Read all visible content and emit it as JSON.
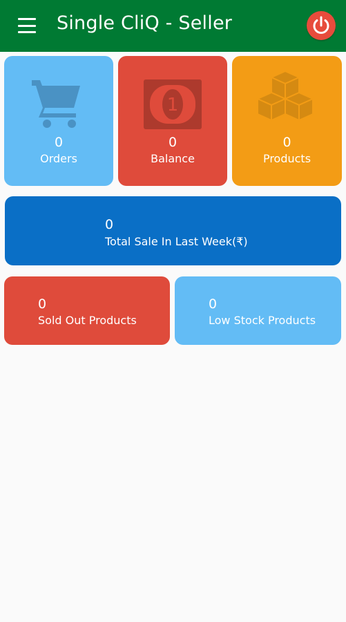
{
  "header": {
    "title": "Single CliQ - Seller",
    "menu_icon": "hamburger-menu-icon",
    "power_icon": "power-icon",
    "bar_color": "#007a33"
  },
  "dashboard": {
    "orders": {
      "value": "0",
      "label": "Orders",
      "icon": "shopping-cart-icon",
      "color": "#63bcf5"
    },
    "balance": {
      "value": "0",
      "label": "Balance",
      "icon": "banknote-icon",
      "color": "#df4b3b"
    },
    "products": {
      "value": "0",
      "label": "Products",
      "icon": "boxes-icon",
      "color": "#f39c15"
    },
    "weekly_sale": {
      "value": "0",
      "label": "Total Sale In Last Week(₹)",
      "color": "#0a6fc6"
    },
    "sold_out": {
      "value": "0",
      "label": "Sold Out Products",
      "color": "#df4b3b"
    },
    "low_stock": {
      "value": "0",
      "label": "Low Stock Products",
      "color": "#63bcf5"
    }
  }
}
